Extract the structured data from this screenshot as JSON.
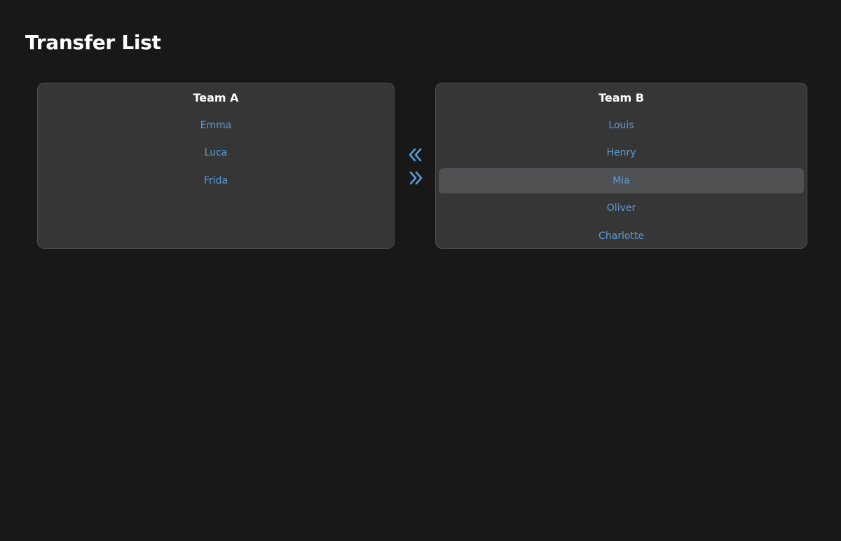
{
  "page": {
    "title": "Transfer List"
  },
  "colors": {
    "background": "#181818",
    "panel": "#363636",
    "panel_border": "#4f4f4f",
    "item_text": "#5b9bd8",
    "selected_item_bg": "#505153",
    "title_text": "#ffffff"
  },
  "lists": {
    "left": {
      "title": "Team A",
      "items": [
        "Emma",
        "Luca",
        "Frida"
      ]
    },
    "right": {
      "title": "Team B",
      "items": [
        "Louis",
        "Henry",
        "Mia",
        "Oliver",
        "Charlotte"
      ],
      "selected": "Mia"
    }
  },
  "controls": {
    "move_left_icon": "double-chevron-left-icon",
    "move_right_icon": "double-chevron-right-icon"
  }
}
